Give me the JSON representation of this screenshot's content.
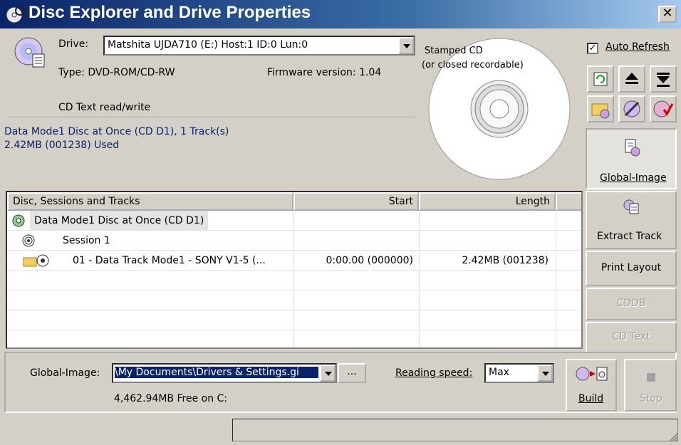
{
  "window": {
    "title": "Disc Explorer and Drive Properties",
    "close_glyph": "✕"
  },
  "drive": {
    "label": "Drive:",
    "value": "Matshita UJDA710 (E:) Host:1 ID:0 Lun:0",
    "type": "Type: DVD-ROM/CD-RW",
    "firmware": "Firmware version: 1.04",
    "cd_text": "CD Text read/write"
  },
  "disc_info": {
    "line1": "Data Mode1 Disc at Once (CD D1), 1 Track(s)",
    "line2": "2.42MB (001238) Used"
  },
  "disc_image": {
    "caption1": "Stamped CD",
    "caption2": "(or closed recordable)"
  },
  "auto_refresh": {
    "label": "Auto Refresh",
    "checked": true
  },
  "toolbar_icons": [
    "refresh-icon",
    "eject-icon",
    "load-icon",
    "folder-disc-icon",
    "disc-tools-icon",
    "disc-check-icon"
  ],
  "side_buttons": {
    "global_image": "Global-Image",
    "extract_track": "Extract Track",
    "print_layout": "Print Layout",
    "cddb": "CDDB",
    "cd_text": "CD Text"
  },
  "table": {
    "headers": [
      "Disc, Sessions and Tracks",
      "Start",
      "Length"
    ],
    "rows": [
      {
        "name": "Data Mode1 Disc at Once (CD D1)",
        "start": "",
        "length": ""
      },
      {
        "name": "Session 1",
        "start": "",
        "length": ""
      },
      {
        "name": "01 - Data Track Mode1 - SONY V1-5  (...",
        "start": "0:00.00 (000000)",
        "length": "2.42MB (001238)"
      }
    ]
  },
  "image_path": {
    "label": "Global-Image:",
    "value": "\\My Documents\\Drivers & Settings.gi",
    "browse": "...",
    "free_space": "4,462.94MB Free on C:"
  },
  "reading_speed": {
    "label": "Reading speed:",
    "value": "Max"
  },
  "actions": {
    "build": "Build",
    "stop": "Stop"
  }
}
